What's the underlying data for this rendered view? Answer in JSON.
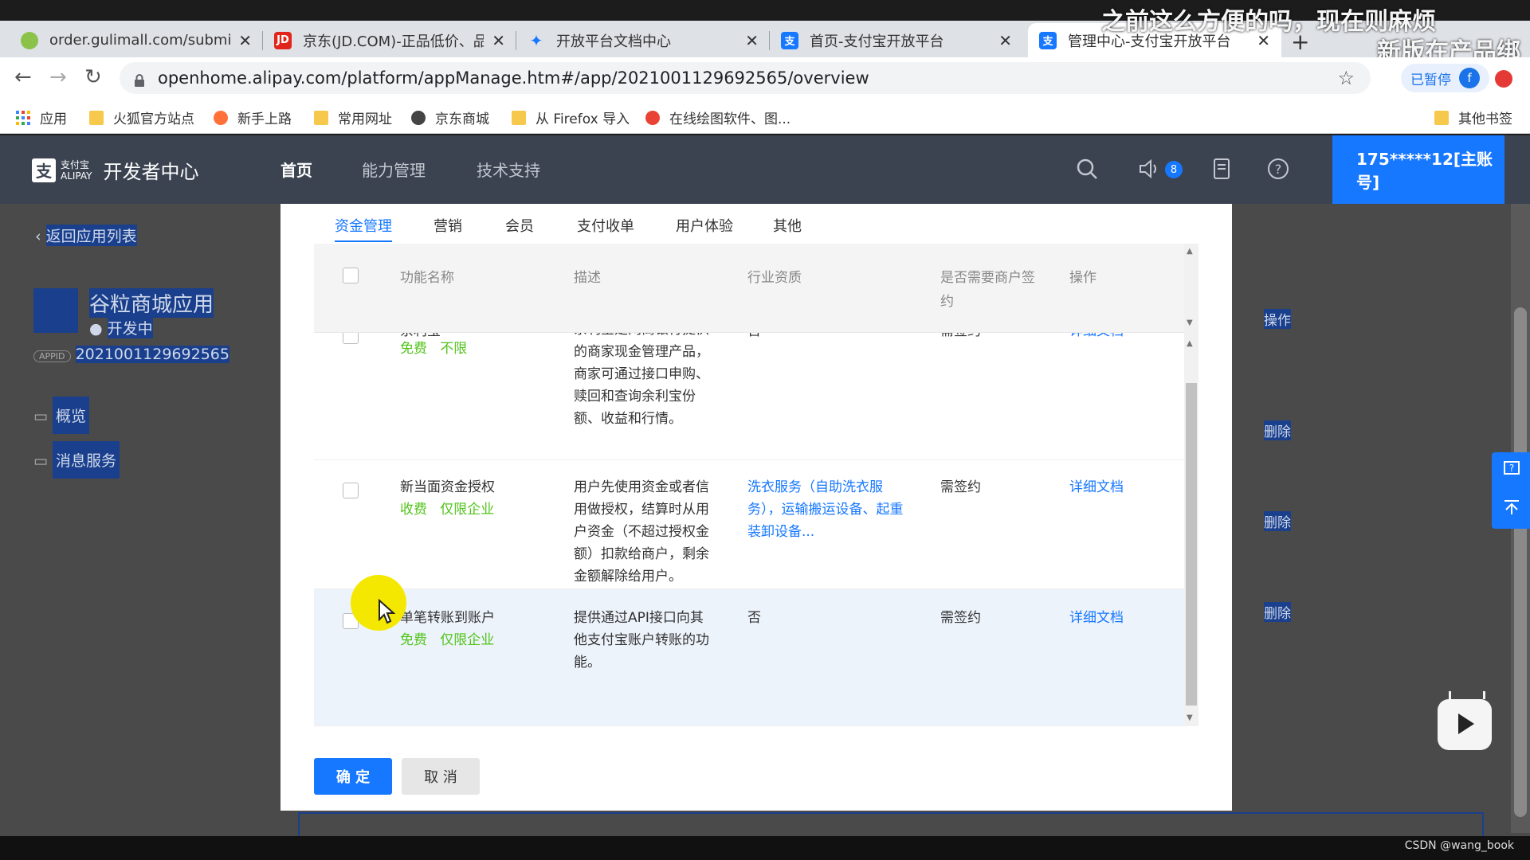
{
  "browser": {
    "tabs": [
      {
        "title": "order.gulimall.com/submitO",
        "favicon_color": "#8bc34a"
      },
      {
        "title": "京东(JD.COM)-正品低价、品",
        "favicon_color": "#e1251b",
        "favicon_text": "JD"
      },
      {
        "title": "开放平台文档中心",
        "favicon_color": "#1677ff"
      },
      {
        "title": "首页-支付宝开放平台",
        "favicon_color": "#1677ff",
        "favicon_text": "支"
      },
      {
        "title": "管理中心-支付宝开放平台",
        "favicon_color": "#1677ff",
        "favicon_text": "支"
      }
    ],
    "new_tab": "+",
    "url": "openhome.alipay.com/platform/appManage.htm#/app/2021001129692565/overview",
    "paused_label": "已暂停",
    "profile_initial": "f",
    "bookmarks": [
      "应用",
      "火狐官方站点",
      "新手上路",
      "常用网址",
      "京东商城",
      "从 Firefox 导入",
      "在线绘图软件、图...",
      "其他书签"
    ]
  },
  "overlay": {
    "line1": "之前这么方便的吗，现在则麻烦",
    "line2": "新版在产品绑"
  },
  "header": {
    "logo_mark": "支",
    "brand_top": "支付宝",
    "brand_bottom": "ALIPAY",
    "title": "开发者中心",
    "nav": [
      "首页",
      "能力管理",
      "技术支持"
    ],
    "notification_count": "8",
    "account": "175*****12[主账号]"
  },
  "background_page": {
    "back_link": "返回应用列表",
    "app_name": "谷粒商城应用",
    "app_status": "开发中",
    "appid_label": "APPID",
    "appid": "2021001129692565",
    "menu": [
      "概览",
      "消息服务"
    ],
    "right_actions": [
      "操作",
      "删除",
      "删除",
      "删除"
    ]
  },
  "modal": {
    "tabs": [
      "资金管理",
      "营销",
      "会员",
      "支付收单",
      "用户体验",
      "其他"
    ],
    "active_tab": 0,
    "columns": [
      "功能名称",
      "描述",
      "行业资质",
      "是否需要商户签约",
      "操作"
    ],
    "rows": [
      {
        "name": "余利宝",
        "tags": [
          "免费",
          "不限"
        ],
        "description": "余利宝是网商银行提供的商家现金管理产品，商家可通过接口申购、赎回和查询余利宝份额、收益和行情。",
        "qualification": "否",
        "sign": "需签约",
        "action": "详细文档"
      },
      {
        "name": "新当面资金授权",
        "tags": [
          "收费",
          "仅限企业"
        ],
        "description": "用户先使用资金或者信用做授权，结算时从用户资金（不超过授权金额）扣款给商户，剩余金额解除给用户。",
        "qualification": "洗衣服务（自助洗衣服务），运输搬运设备、起重装卸设备...",
        "sign": "需签约",
        "action": "详细文档"
      },
      {
        "name": "单笔转账到账户",
        "tags": [
          "免费",
          "仅限企业"
        ],
        "description": "提供通过API接口向其他支付宝账户转账的功能。",
        "qualification": "否",
        "sign": "需签约",
        "action": "详细文档"
      }
    ],
    "confirm": "确 定",
    "cancel": "取 消"
  },
  "footer": {
    "watermark": "CSDN @wang_book"
  }
}
